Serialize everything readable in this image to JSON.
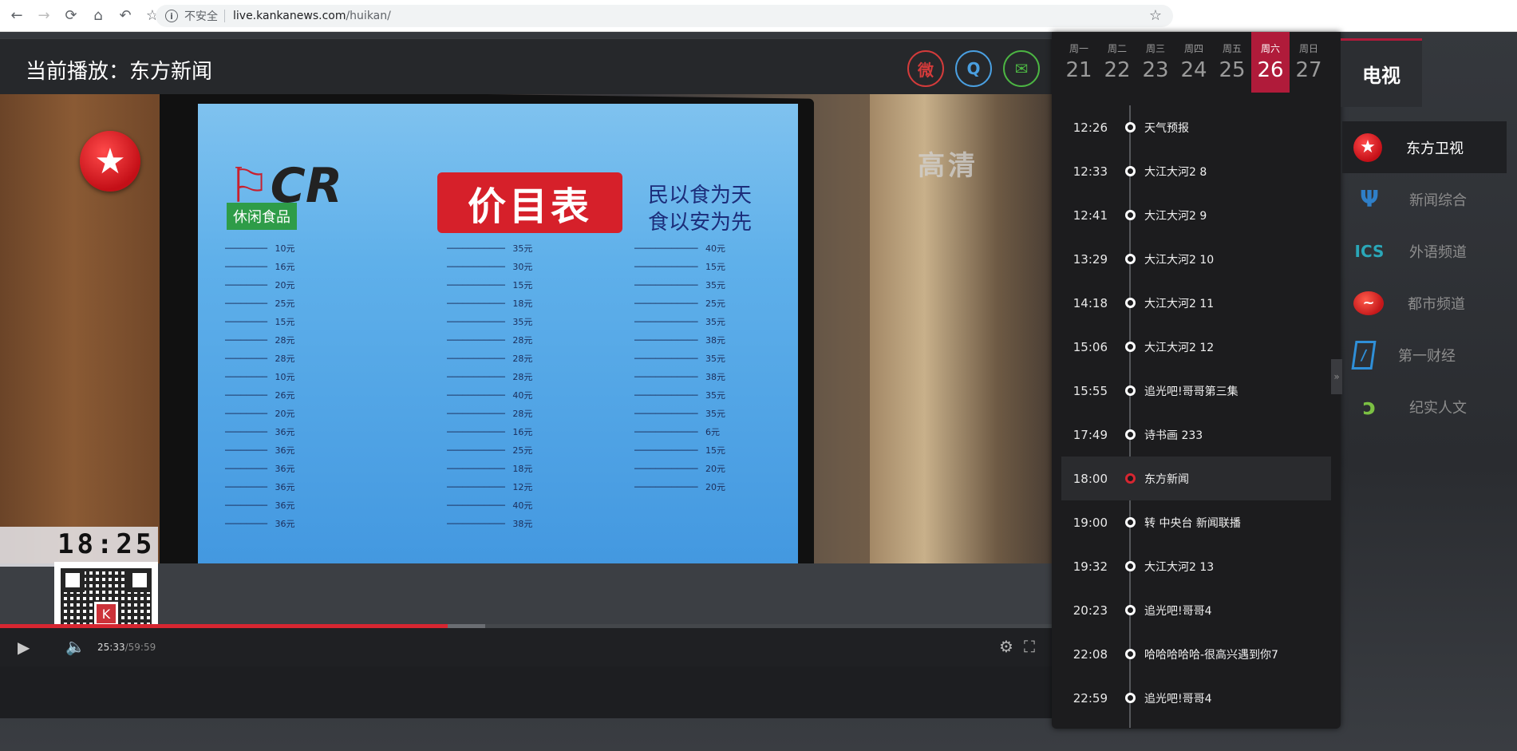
{
  "browser": {
    "back_icon": "arrow-left-icon",
    "insecure_label": "不安全",
    "url_host": "live.kankanews.com",
    "url_path": "/huikan/"
  },
  "player": {
    "now_playing": "当前播放：东方新闻",
    "share": [
      "weibo-icon",
      "qq-icon",
      "wechat-icon"
    ],
    "video": {
      "watermark": "高清",
      "clock": "18:25",
      "price_title": "价目表",
      "snack_tag": "休闲食品",
      "slogan_line1": "民以食为天",
      "slogan_line2": "食以安为先",
      "cr_logo": "CR"
    },
    "time_current": "25:33",
    "time_total": "/59:59",
    "progress_fraction": 0.426,
    "buffered_fraction": 0.461
  },
  "schedule": {
    "days": [
      {
        "weekday": "周一",
        "date": "21"
      },
      {
        "weekday": "周二",
        "date": "22"
      },
      {
        "weekday": "周三",
        "date": "23"
      },
      {
        "weekday": "周四",
        "date": "24"
      },
      {
        "weekday": "周五",
        "date": "25"
      },
      {
        "weekday": "周六",
        "date": "26",
        "active": true
      },
      {
        "weekday": "周日",
        "date": "27"
      }
    ],
    "programs": [
      {
        "time": "12:26",
        "name": "天气预报"
      },
      {
        "time": "12:33",
        "name": "大江大河2 8"
      },
      {
        "time": "12:41",
        "name": "大江大河2 9"
      },
      {
        "time": "13:29",
        "name": "大江大河2 10"
      },
      {
        "time": "14:18",
        "name": "大江大河2 11"
      },
      {
        "time": "15:06",
        "name": "大江大河2 12"
      },
      {
        "time": "15:55",
        "name": "追光吧!哥哥第三集"
      },
      {
        "time": "17:49",
        "name": "诗书画 233"
      },
      {
        "time": "18:00",
        "name": "东方新闻",
        "current": true
      },
      {
        "time": "19:00",
        "name": "转 中央台 新闻联播"
      },
      {
        "time": "19:32",
        "name": "大江大河2 13"
      },
      {
        "time": "20:23",
        "name": "追光吧!哥哥4"
      },
      {
        "time": "22:08",
        "name": "哈哈哈哈哈-很高兴遇到你7"
      },
      {
        "time": "22:59",
        "name": "追光吧!哥哥4"
      }
    ]
  },
  "nav": {
    "tv_tab": "电视",
    "channels": [
      {
        "name": "东方卫视",
        "icon": "dongfang-star-icon",
        "active": true
      },
      {
        "name": "新闻综合",
        "icon": "news-u-icon"
      },
      {
        "name": "外语频道",
        "icon": "ics-icon"
      },
      {
        "name": "都市频道",
        "icon": "dushi-icon"
      },
      {
        "name": "第一财经",
        "icon": "caijing-icon"
      },
      {
        "name": "纪实人文",
        "icon": "jishi-icon"
      }
    ]
  }
}
